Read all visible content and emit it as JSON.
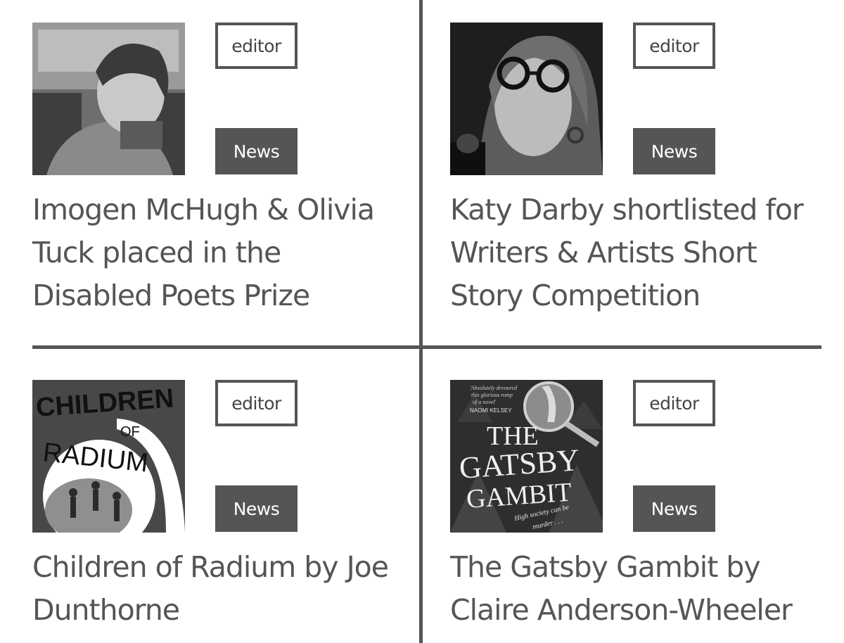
{
  "posts": [
    {
      "author": "editor",
      "category": "News",
      "title": "Imogen McHugh & Olivia Tuck placed in the Disabled Poets Prize"
    },
    {
      "author": "editor",
      "category": "News",
      "title": "Katy Darby shortlisted for Writers & Artists Short Story Competition"
    },
    {
      "author": "editor",
      "category": "News",
      "title": "Children of Radium by Joe Dunthorne",
      "cover": {
        "line1": "CHILDREN",
        "line2": "OF",
        "line3": "RADIUM"
      }
    },
    {
      "author": "editor",
      "category": "News",
      "title": "The Gatsby Gambit by Claire Anderson-Wheeler",
      "cover": {
        "quote1": "'Absolutely devoured",
        "quote2": "this glorious romp",
        "quote3": "of a novel'",
        "quote_author": "NAOMI KELSEY",
        "word1": "THE",
        "word2": "GATSBY",
        "word3": "GAMBIT",
        "tagline1": "High society can be",
        "tagline2": "murder . . ."
      }
    }
  ],
  "colors": {
    "accent": "#555555",
    "background": "#ffffff"
  }
}
